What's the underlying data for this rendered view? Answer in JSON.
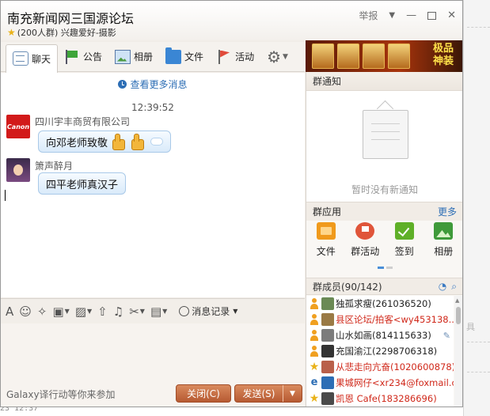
{
  "window": {
    "title": "南充新闻网三国源论坛",
    "subtitle": "(200人群) 兴趣爱好-摄影",
    "report_label": "举报"
  },
  "tabs": [
    {
      "label": "聊天",
      "icon": "chat-icon"
    },
    {
      "label": "公告",
      "icon": "flag-icon"
    },
    {
      "label": "相册",
      "icon": "album-icon"
    },
    {
      "label": "文件",
      "icon": "folder-icon"
    },
    {
      "label": "活动",
      "icon": "red-flag-icon"
    }
  ],
  "banner": {
    "text": "极品神装"
  },
  "chat": {
    "view_more": "查看更多消息",
    "timestamp": "12:39:52",
    "avatar_text": "Canon",
    "messages": [
      {
        "sender": "四川宇丰商贸有限公司",
        "text": "向邓老师致敬"
      },
      {
        "sender": "箫声醉月",
        "text": "四平老师真汉子"
      }
    ]
  },
  "input": {
    "history_label": "消息记录",
    "promo": "Galaxy译行动等你来参加",
    "close_label": "关闭(C)",
    "send_label": "发送(S)"
  },
  "notice": {
    "header": "群通知",
    "empty_text": "暂时没有新通知"
  },
  "apps": {
    "header": "群应用",
    "more": "更多",
    "items": [
      {
        "label": "文件"
      },
      {
        "label": "群活动"
      },
      {
        "label": "签到"
      },
      {
        "label": "相册"
      }
    ]
  },
  "members": {
    "header": "群成员(90/142)",
    "items": [
      {
        "name": "独孤求瘦(261036520)",
        "red": false,
        "badge": "person"
      },
      {
        "name": "县区论坛/拍客<wy453138...",
        "red": true,
        "badge": "person"
      },
      {
        "name": "山水如画(814115633)",
        "red": false,
        "badge": "person"
      },
      {
        "name": "充国渝江(2298706318)",
        "red": false,
        "badge": "person"
      },
      {
        "name": "从悲走向亢奋(1020600878)",
        "red": true,
        "badge": "star"
      },
      {
        "name": "果城网仔<xr234@foxmail.c...",
        "red": true,
        "badge": "ie"
      },
      {
        "name": "凯恩  Cafe(183286696)",
        "red": true,
        "badge": "star"
      }
    ]
  },
  "background": {
    "ghost_text": "具",
    "bottom_text": "23 12:37"
  },
  "colors": {
    "accent_blue": "#2d6eb5",
    "button_orange": "#c76e44",
    "member_red": "#d0281a"
  }
}
